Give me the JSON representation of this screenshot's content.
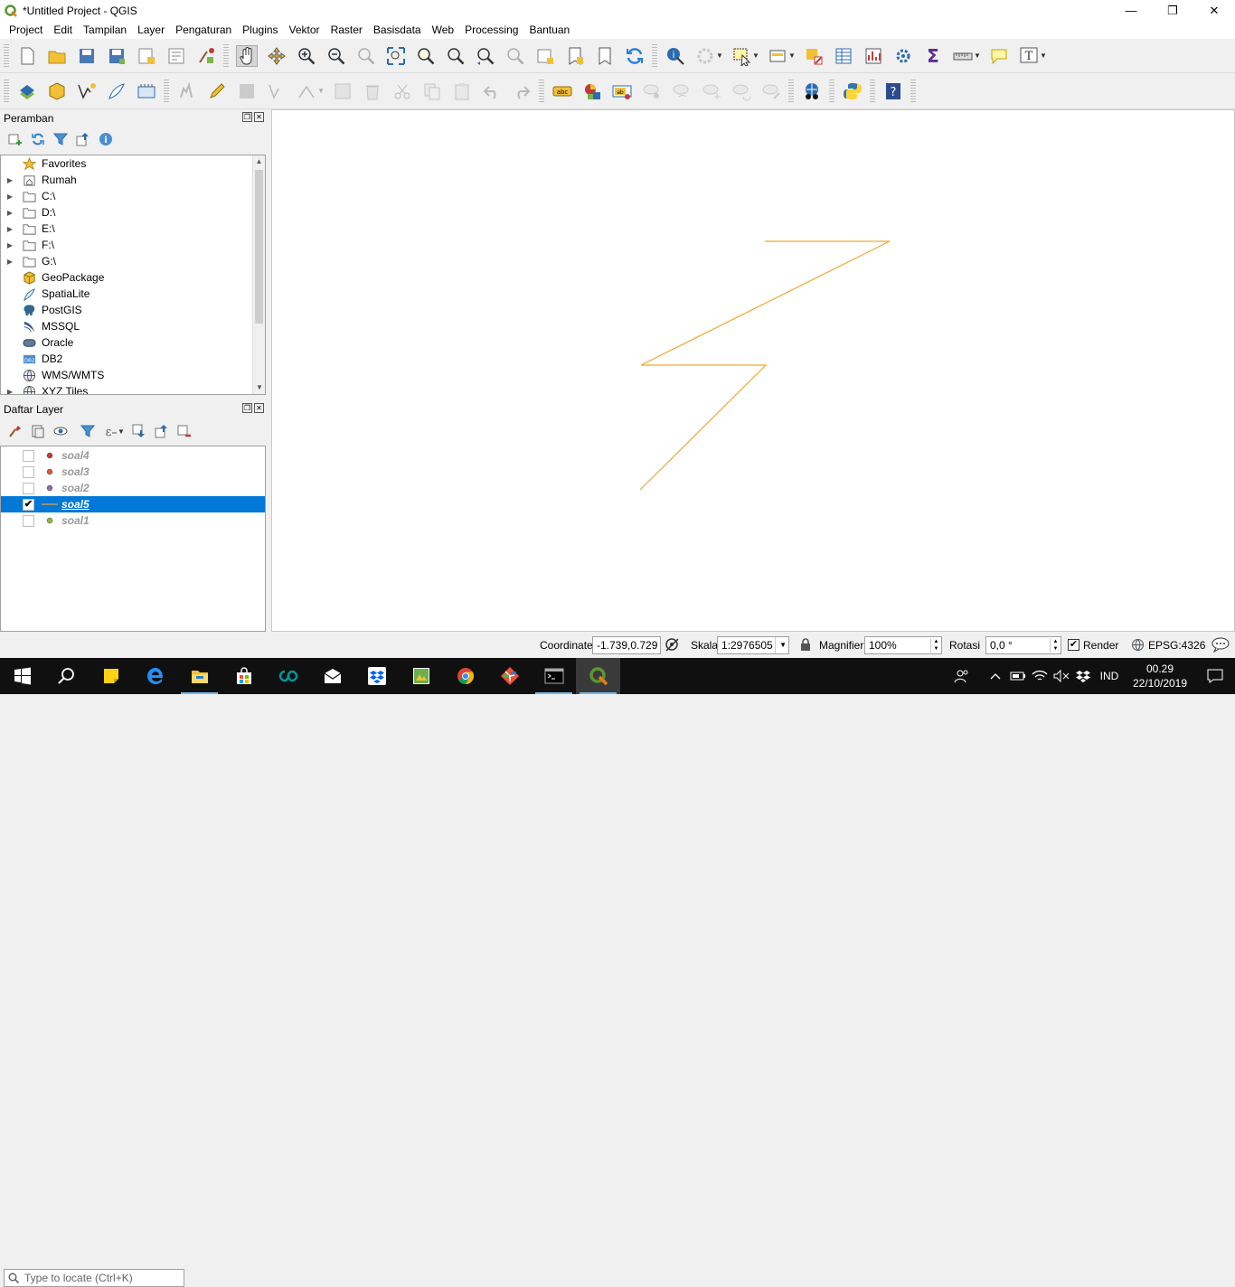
{
  "window": {
    "title": "*Untitled Project - QGIS",
    "controls": [
      "minimize",
      "restore",
      "close"
    ]
  },
  "menu": [
    "Project",
    "Edit",
    "Tampilan",
    "Layer",
    "Pengaturan",
    "Plugins",
    "Vektor",
    "Raster",
    "Basisdata",
    "Web",
    "Processing",
    "Bantuan"
  ],
  "browser": {
    "title": "Peramban",
    "items": [
      {
        "label": "Favorites",
        "icon": "star-icon",
        "expandable": false
      },
      {
        "label": "Rumah",
        "icon": "home-folder-icon",
        "expandable": true
      },
      {
        "label": "C:\\",
        "icon": "folder-icon",
        "expandable": true
      },
      {
        "label": "D:\\",
        "icon": "folder-icon",
        "expandable": true
      },
      {
        "label": "E:\\",
        "icon": "folder-icon",
        "expandable": true
      },
      {
        "label": "F:\\",
        "icon": "folder-icon",
        "expandable": true
      },
      {
        "label": "G:\\",
        "icon": "folder-icon",
        "expandable": true
      },
      {
        "label": "GeoPackage",
        "icon": "geopackage-icon",
        "expandable": false
      },
      {
        "label": "SpatiaLite",
        "icon": "spatialite-icon",
        "expandable": false
      },
      {
        "label": "PostGIS",
        "icon": "postgis-icon",
        "expandable": false
      },
      {
        "label": "MSSQL",
        "icon": "mssql-icon",
        "expandable": false
      },
      {
        "label": "Oracle",
        "icon": "oracle-icon",
        "expandable": false
      },
      {
        "label": "DB2",
        "icon": "db2-icon",
        "expandable": false
      },
      {
        "label": "WMS/WMTS",
        "icon": "wms-globe-icon",
        "expandable": false
      },
      {
        "label": "XYZ Tiles",
        "icon": "xyz-globe-icon",
        "expandable": true
      }
    ]
  },
  "layers": {
    "title": "Daftar Layer",
    "items": [
      {
        "name": "soal4",
        "checked": false,
        "selected": false,
        "symbol": "point",
        "color": "#c23a3a"
      },
      {
        "name": "soal3",
        "checked": false,
        "selected": false,
        "symbol": "point",
        "color": "#d4583c"
      },
      {
        "name": "soal2",
        "checked": false,
        "selected": false,
        "symbol": "point",
        "color": "#8a6aa8"
      },
      {
        "name": "soal5",
        "checked": true,
        "selected": true,
        "symbol": "line",
        "color": "#e8a23c"
      },
      {
        "name": "soal1",
        "checked": false,
        "selected": false,
        "symbol": "point",
        "color": "#8fb838"
      }
    ]
  },
  "canvas": {
    "line_color": "#f0a830"
  },
  "statusbar": {
    "locate_placeholder": "Type to locate (Ctrl+K)",
    "coordinate_label": "Coordinate",
    "coordinate_value": "-1.739,0.729",
    "scale_label": "Skala",
    "scale_value": "1:2976505",
    "magnifier_label": "Magnifier",
    "magnifier_value": "100%",
    "rotation_label": "Rotasi",
    "rotation_value": "0,0 °",
    "render_label": "Render",
    "render_checked": true,
    "crs": "EPSG:4326"
  },
  "taskbar": {
    "apps": [
      "windows-start",
      "search",
      "sticky-notes",
      "edge",
      "file-explorer",
      "store",
      "arduino",
      "mail",
      "dropbox",
      "gis-app",
      "chrome",
      "git",
      "cmd",
      "qgis"
    ],
    "lang": "IND",
    "time": "00.29",
    "date": "22/10/2019"
  }
}
